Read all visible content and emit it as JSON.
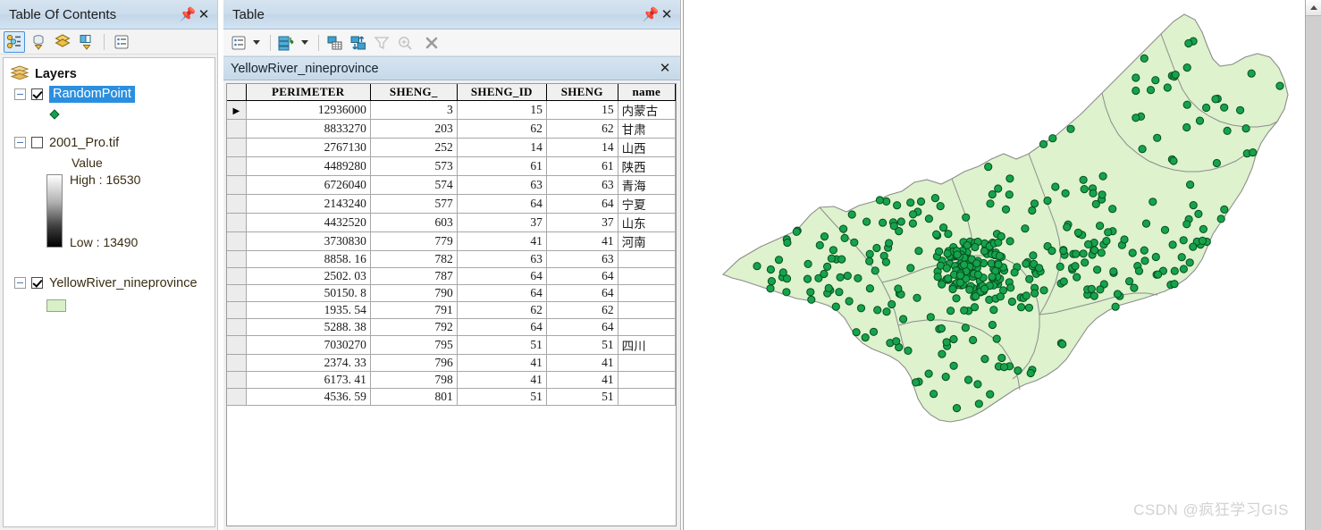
{
  "toc": {
    "title": "Table Of Contents",
    "pin_icon": "pin-icon",
    "close_icon": "close-icon",
    "toolbar": [
      {
        "name": "list-by-drawing-order-icon",
        "label": "List By Drawing Order",
        "selected": true
      },
      {
        "name": "list-by-source-icon",
        "label": "List By Source",
        "selected": false
      },
      {
        "name": "list-by-visibility-icon",
        "label": "List By Visibility",
        "selected": false
      },
      {
        "name": "list-by-selection-icon",
        "label": "List By Selection",
        "selected": false
      },
      {
        "name": "options-icon",
        "label": "Options",
        "selected": false
      }
    ],
    "root": "Layers",
    "layers": [
      {
        "name": "RandomPoint",
        "checked": true,
        "selected": true,
        "symbol": "point",
        "symbol_color": "#15a04e"
      },
      {
        "name": "2001_Pro.tif",
        "checked": false,
        "selected": false,
        "symbol": "raster",
        "value_label": "Value",
        "high_label": "High : 16530",
        "low_label": "Low : 13490"
      },
      {
        "name": "YellowRiver_nineprovince",
        "checked": true,
        "selected": false,
        "symbol": "polygon",
        "symbol_color": "#d8f0c8"
      }
    ]
  },
  "table_panel": {
    "title": "Table",
    "pin_icon": "pin-icon",
    "close_icon": "close-icon",
    "tab_label": "YellowRiver_nineprovince",
    "tab_close_icon": "close-icon",
    "toolbar": [
      {
        "name": "table-options-icon",
        "label": "Table Options",
        "dropdown": true,
        "disabled": false
      },
      {
        "name": "related-tables-icon",
        "label": "Related Tables",
        "dropdown": true,
        "disabled": false
      },
      {
        "name": "select-by-attributes-icon",
        "label": "Select By Attributes",
        "dropdown": false,
        "disabled": false
      },
      {
        "name": "switch-selection-icon",
        "label": "Switch Selection",
        "dropdown": false,
        "disabled": false
      },
      {
        "name": "zoom-to-selected-icon",
        "label": "Zoom To Selected",
        "dropdown": false,
        "disabled": true
      },
      {
        "name": "zoom-to-icon",
        "label": "Zoom To",
        "dropdown": false,
        "disabled": true
      },
      {
        "name": "clear-selection-icon",
        "label": "Clear Selection",
        "dropdown": false,
        "disabled": false
      }
    ],
    "columns": [
      "PERIMETER",
      "SHENG_",
      "SHENG_ID",
      "SHENG",
      "name"
    ],
    "current_row": 0,
    "rows": [
      {
        "PERIMETER": "12936000",
        "SHENG_": "3",
        "SHENG_ID": "15",
        "SHENG": "15",
        "name": "内蒙古"
      },
      {
        "PERIMETER": "8833270",
        "SHENG_": "203",
        "SHENG_ID": "62",
        "SHENG": "62",
        "name": "甘肃"
      },
      {
        "PERIMETER": "2767130",
        "SHENG_": "252",
        "SHENG_ID": "14",
        "SHENG": "14",
        "name": "山西"
      },
      {
        "PERIMETER": "4489280",
        "SHENG_": "573",
        "SHENG_ID": "61",
        "SHENG": "61",
        "name": "陕西"
      },
      {
        "PERIMETER": "6726040",
        "SHENG_": "574",
        "SHENG_ID": "63",
        "SHENG": "63",
        "name": "青海"
      },
      {
        "PERIMETER": "2143240",
        "SHENG_": "577",
        "SHENG_ID": "64",
        "SHENG": "64",
        "name": "宁夏"
      },
      {
        "PERIMETER": "4432520",
        "SHENG_": "603",
        "SHENG_ID": "37",
        "SHENG": "37",
        "name": "山东"
      },
      {
        "PERIMETER": "3730830",
        "SHENG_": "779",
        "SHENG_ID": "41",
        "SHENG": "41",
        "name": "河南"
      },
      {
        "PERIMETER": "8858. 16",
        "SHENG_": "782",
        "SHENG_ID": "63",
        "SHENG": "63",
        "name": ""
      },
      {
        "PERIMETER": "2502. 03",
        "SHENG_": "787",
        "SHENG_ID": "64",
        "SHENG": "64",
        "name": ""
      },
      {
        "PERIMETER": "50150. 8",
        "SHENG_": "790",
        "SHENG_ID": "64",
        "SHENG": "64",
        "name": ""
      },
      {
        "PERIMETER": "1935. 54",
        "SHENG_": "791",
        "SHENG_ID": "62",
        "SHENG": "62",
        "name": ""
      },
      {
        "PERIMETER": "5288. 38",
        "SHENG_": "792",
        "SHENG_ID": "64",
        "SHENG": "64",
        "name": ""
      },
      {
        "PERIMETER": "7030270",
        "SHENG_": "795",
        "SHENG_ID": "51",
        "SHENG": "51",
        "name": "四川"
      },
      {
        "PERIMETER": "2374. 33",
        "SHENG_": "796",
        "SHENG_ID": "41",
        "SHENG": "41",
        "name": ""
      },
      {
        "PERIMETER": "6173. 41",
        "SHENG_": "798",
        "SHENG_ID": "41",
        "SHENG": "41",
        "name": ""
      },
      {
        "PERIMETER": "4536. 59",
        "SHENG_": "801",
        "SHENG_ID": "51",
        "SHENG": "51",
        "name": ""
      }
    ]
  },
  "map": {
    "polygon_fill": "#ddf2cd",
    "polygon_stroke": "#8d8d8d",
    "point_fill": "#16a34a",
    "point_stroke": "#064e23",
    "watermark": "CSDN @疯狂学习GIS"
  },
  "scrollbar": {
    "up_arrow_icon": "chevron-up-icon"
  }
}
